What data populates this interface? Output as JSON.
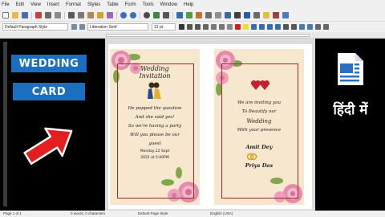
{
  "menu": [
    "File",
    "Edit",
    "View",
    "Insert",
    "Format",
    "Styles",
    "Table",
    "Form",
    "Tools",
    "Window",
    "Help"
  ],
  "format_bar": {
    "paragraph_style": "Default Paragraph Style",
    "font_name": "Liberation Serif",
    "font_size": "12 pt"
  },
  "labels": {
    "wedding": "WEDDING",
    "card": "CARD",
    "hindi": "हिंदी में"
  },
  "left_card": {
    "title_1": "Wedding",
    "title_2": "Invitation",
    "line_1": "He popped the question",
    "line_2": "And she said yes!",
    "line_3": "So we're having a party",
    "line_4": "Will you please be our",
    "line_5": "guest",
    "date_1": "Monday,12 Sept",
    "date_2": "2022 at 5:00PM"
  },
  "right_card": {
    "line_1": "We are inviting you",
    "line_2": "To Beautify our",
    "line_3": "Wedding",
    "line_4": "With your presence",
    "name_1": "Amit Dey",
    "name_2": "Priya Das"
  },
  "status": {
    "page": "Page 1 of 1",
    "words": "0 words, 0 characters",
    "page_style": "Default Page Style",
    "language": "English (USA)"
  },
  "colors": {
    "label_blue": "#1a6fc0",
    "arrow_red": "#e41e1e",
    "card_bg": "#f7e7cf",
    "card_border": "#a02a2a",
    "rose_pink": "#e9a0b8"
  },
  "icons": [
    "writer-logo-icon",
    "arrow-right-icon",
    "rose-icon",
    "heart-icon",
    "ring-icon",
    "couple-icon"
  ]
}
